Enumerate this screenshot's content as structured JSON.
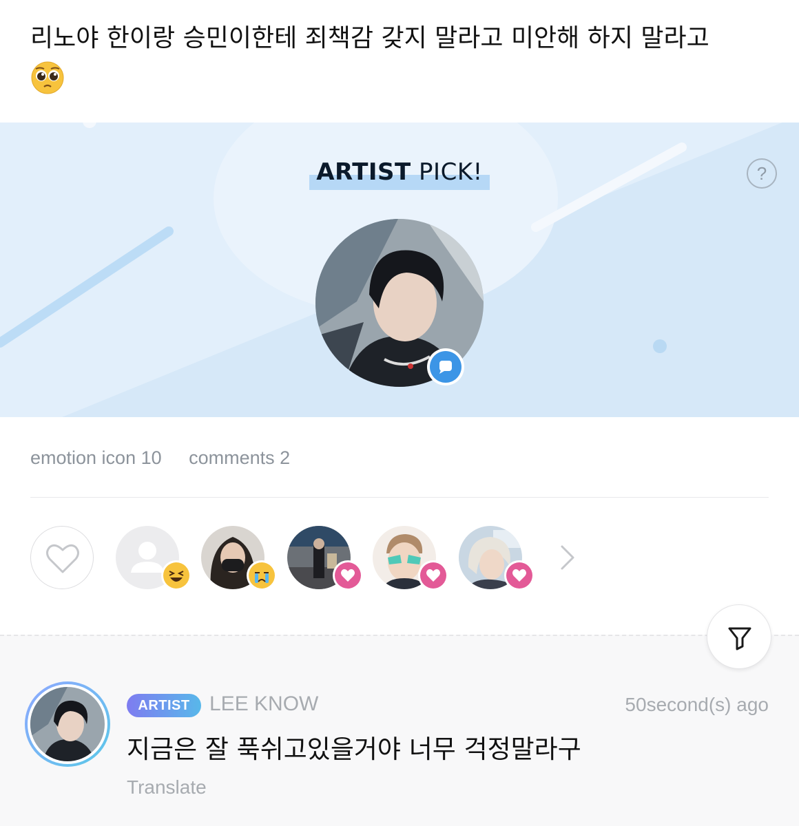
{
  "post": {
    "text": "리노야 한이랑 승민이한테 죄책감 갖지 말라고 미안해 하지 말라고",
    "emoji": "pleading-face"
  },
  "banner": {
    "title_bold": "ARTIST",
    "title_light": "PICK!",
    "help_label": "?"
  },
  "stats": {
    "emotion": "emotion icon 10",
    "comments": "comments 2"
  },
  "reactions": [
    {
      "user": "default-profile",
      "emotion": "laughing"
    },
    {
      "user": "user-2",
      "emotion": "crying"
    },
    {
      "user": "user-3",
      "emotion": "heart"
    },
    {
      "user": "user-4",
      "emotion": "heart"
    },
    {
      "user": "user-5",
      "emotion": "heart"
    }
  ],
  "comment": {
    "badge": "ARTIST",
    "author": "LEE KNOW",
    "time": "50second(s) ago",
    "text": "지금은 잘 푹쉬고있을거야 너무 걱정말라구",
    "translate": "Translate"
  },
  "colors": {
    "banner_bg": "#e2effb",
    "accent_blue": "#3c95e6",
    "heart_pink": "#e35a97",
    "muted_text": "#8c939b"
  }
}
